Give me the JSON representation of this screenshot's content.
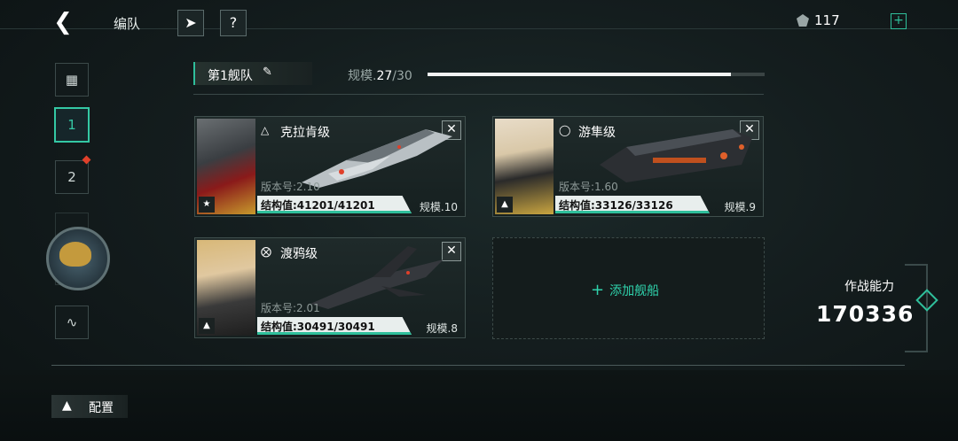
{
  "header": {
    "title": "编队",
    "currency_value": "117",
    "plus": "+"
  },
  "sidebar": {
    "fleets": [
      "1",
      "2"
    ]
  },
  "fleet": {
    "name": "第1舰队",
    "scale_label": "规模.",
    "scale_value": "27",
    "scale_max": "/30",
    "scale_fraction": 0.9
  },
  "ships": [
    {
      "name": "克拉肯级",
      "version": "版本号:2.10",
      "hp": "结构值:41201/41201",
      "scale": "规模.10",
      "hp_fraction": 1.0
    },
    {
      "name": "游隼级",
      "version": "版本号:1.60",
      "hp": "结构值:33126/33126",
      "scale": "规模.9",
      "hp_fraction": 1.0
    },
    {
      "name": "渡鸦级",
      "version": "版本号:2.01",
      "hp": "结构值:30491/30491",
      "scale": "规模.8",
      "hp_fraction": 1.0
    }
  ],
  "add_ship_label": "添加舰船",
  "power": {
    "label": "作战能力",
    "value": "170336"
  },
  "bottom": {
    "config_label": "配置"
  },
  "colors": {
    "accent": "#2fbf9b",
    "alert": "#e0402a"
  }
}
